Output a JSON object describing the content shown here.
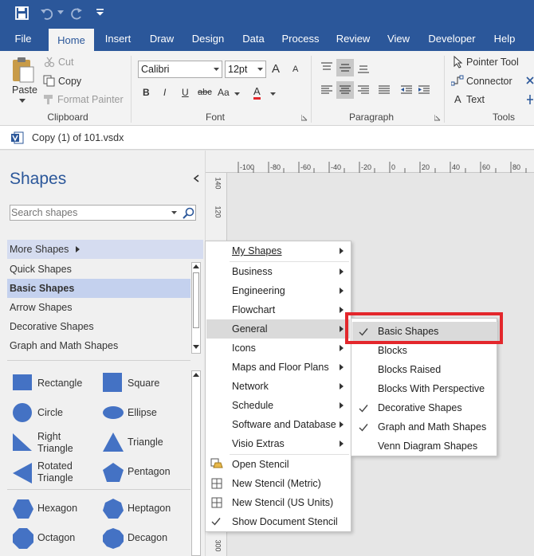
{
  "ribbon_tabs": [
    "File",
    "Home",
    "Insert",
    "Draw",
    "Design",
    "Data",
    "Process",
    "Review",
    "View",
    "Developer",
    "Help"
  ],
  "clipboard": {
    "paste": "Paste",
    "cut": "Cut",
    "copy": "Copy",
    "format_painter": "Format Painter",
    "group": "Clipboard"
  },
  "font": {
    "name": "Calibri",
    "size": "12pt",
    "group": "Font",
    "grow": "A",
    "shrink": "A",
    "bold": "B",
    "italic": "I",
    "underline": "U",
    "strike": "abc",
    "case": "Aa",
    "color": "A"
  },
  "paragraph": {
    "group": "Paragraph"
  },
  "tools": {
    "pointer": "Pointer Tool",
    "connector": "Connector",
    "text": "Text",
    "group": "Tools",
    "text_glyph": "A"
  },
  "document": {
    "title": "Copy (1) of 101.vsdx"
  },
  "shapes_pane": {
    "title": "Shapes",
    "search_placeholder": "Search shapes",
    "more_shapes": "More Shapes",
    "stencils": [
      "Quick Shapes",
      "Basic Shapes",
      "Arrow Shapes",
      "Decorative Shapes",
      "Graph and Math Shapes"
    ],
    "shapes": [
      {
        "label": "Rectangle",
        "icon": "rectangle-icon"
      },
      {
        "label": "Square",
        "icon": "square-icon"
      },
      {
        "label": "Circle",
        "icon": "circle-icon"
      },
      {
        "label": "Ellipse",
        "icon": "ellipse-icon"
      },
      {
        "label": "Right\nTriangle",
        "icon": "right-triangle-icon"
      },
      {
        "label": "Triangle",
        "icon": "triangle-icon"
      },
      {
        "label": "Rotated\nTriangle",
        "icon": "rotated-triangle-icon"
      },
      {
        "label": "Pentagon",
        "icon": "pentagon-icon"
      },
      {
        "label": "Hexagon",
        "icon": "hexagon-icon"
      },
      {
        "label": "Heptagon",
        "icon": "heptagon-icon"
      },
      {
        "label": "Octagon",
        "icon": "octagon-icon"
      },
      {
        "label": "Decagon",
        "icon": "decagon-icon"
      }
    ]
  },
  "ruler": {
    "h": [
      "-100",
      "-80",
      "-60",
      "-40",
      "-20",
      "0",
      "20",
      "40",
      "60",
      "80"
    ],
    "v": [
      "140",
      "120",
      "300"
    ]
  },
  "more_shapes_menu": {
    "items": [
      "My Shapes",
      "Business",
      "Engineering",
      "Flowchart",
      "General",
      "Icons",
      "Maps and Floor Plans",
      "Network",
      "Schedule",
      "Software and Database",
      "Visio Extras"
    ],
    "actions": [
      "Open Stencil",
      "New Stencil (Metric)",
      "New Stencil (US Units)",
      "Show Document Stencil"
    ]
  },
  "general_submenu": {
    "items": [
      "Basic Shapes",
      "Blocks",
      "Blocks Raised",
      "Blocks With Perspective",
      "Decorative Shapes",
      "Graph and Math Shapes",
      "Venn Diagram Shapes"
    ]
  },
  "colors": {
    "brand": "#2b579a",
    "highlight": "#e3272c",
    "shape_fill": "#4472c4"
  }
}
